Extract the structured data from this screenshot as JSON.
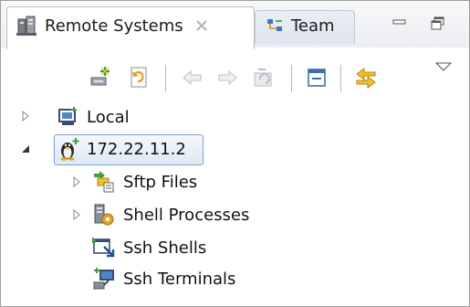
{
  "tabs": [
    {
      "label": "Remote Systems",
      "icon": "remote-systems-icon",
      "active": true
    },
    {
      "label": "Team",
      "icon": "team-icon",
      "active": false
    }
  ],
  "window_controls": [
    "minimize-icon",
    "maximize-icon"
  ],
  "toolbar": {
    "buttons": [
      "new-connection-icon",
      "refresh-icon",
      "back-icon",
      "forward-icon",
      "home-icon",
      "collapse-all-icon",
      "link-with-editor-icon",
      "view-menu-icon"
    ]
  },
  "tree": {
    "local": "Local",
    "host": "172.22.11.2",
    "children": [
      "Sftp Files",
      "Shell Processes",
      "Ssh Shells",
      "Ssh Terminals"
    ]
  },
  "colors": {
    "selection_border": "#7da2ce",
    "selection_fill": "#dde9f7",
    "accent_green": "#3aa53a",
    "accent_orange": "#e8a020"
  }
}
